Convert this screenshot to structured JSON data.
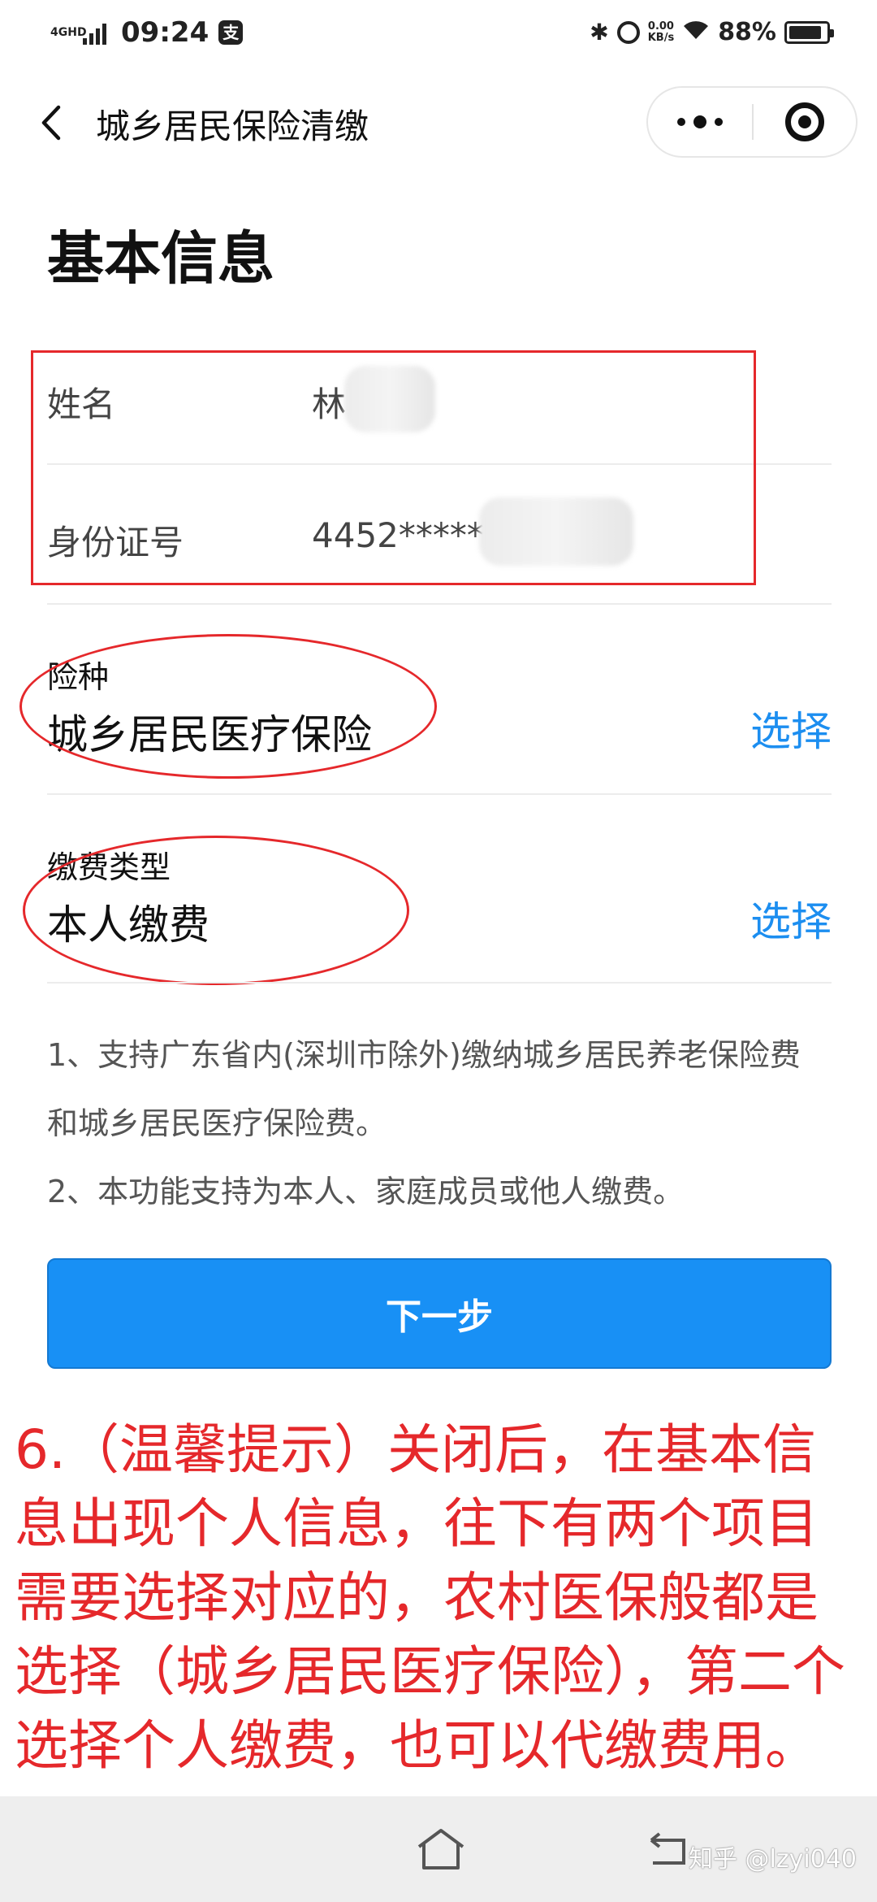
{
  "status_bar": {
    "network": "4GHD",
    "time": "09:24",
    "app_badge": "支",
    "bluetooth": "✱",
    "speed_value": "0.00",
    "speed_unit": "KB/s",
    "battery_percent": "88%",
    "battery_level": 0.88
  },
  "nav": {
    "title": "城乡居民保险清缴"
  },
  "page": {
    "title": "基本信息"
  },
  "basic_info": {
    "name_label": "姓名",
    "name_value": "林",
    "id_label": "身份证号",
    "id_value": "4452*****"
  },
  "insurance_type": {
    "label": "险种",
    "value": "城乡居民医疗保险",
    "action": "选择"
  },
  "payment_type": {
    "label": "缴费类型",
    "value": "本人缴费",
    "action": "选择"
  },
  "notes": {
    "line1": "1、支持广东省内(深圳市除外)缴纳城乡居民养老保险费和城乡居民医疗保险费。",
    "line2": "2、本功能支持为本人、家庭成员或他人缴费。"
  },
  "next_button": {
    "label": "下一步"
  },
  "annotation": {
    "text": "6.（温馨提示）关闭后，在基本信息出现个人信息，往下有两个项目需要选择对应的，农村医保般都是选择（城乡居民医疗保险），第二个选择个人缴费，也可以代缴费用。"
  },
  "watermark": {
    "text": "知乎 @lzyi040"
  },
  "colors": {
    "accent_blue": "#1890f5",
    "link_blue": "#1c8ef0",
    "annotation_red": "#e5282b"
  }
}
